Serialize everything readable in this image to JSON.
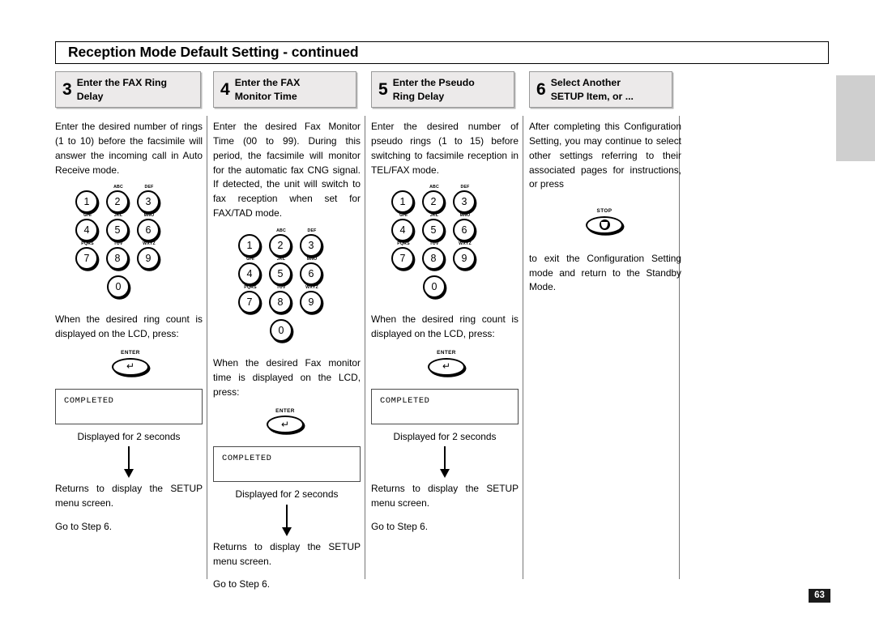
{
  "header": {
    "title": "Reception Mode Default Setting - continued"
  },
  "steps": [
    {
      "number": "3",
      "label_line1": "Enter the FAX Ring",
      "label_line2": "Delay"
    },
    {
      "number": "4",
      "label_line1": "Enter the FAX",
      "label_line2": "Monitor Time"
    },
    {
      "number": "5",
      "label_line1": "Enter the Pseudo",
      "label_line2": "Ring Delay"
    },
    {
      "number": "6",
      "label_line1": "Select Another",
      "label_line2": "SETUP Item, or ..."
    }
  ],
  "keypad": {
    "rows": [
      [
        {
          "digit": "1",
          "letters": ""
        },
        {
          "digit": "2",
          "letters": "ABC"
        },
        {
          "digit": "3",
          "letters": "DEF"
        }
      ],
      [
        {
          "digit": "4",
          "letters": "GHI"
        },
        {
          "digit": "5",
          "letters": "JKL"
        },
        {
          "digit": "6",
          "letters": "MNO"
        }
      ],
      [
        {
          "digit": "7",
          "letters": "PQRS"
        },
        {
          "digit": "8",
          "letters": "TUV"
        },
        {
          "digit": "9",
          "letters": "WXYZ"
        }
      ]
    ],
    "zero": {
      "digit": "0",
      "letters": ""
    }
  },
  "buttons": {
    "enter_label": "ENTER",
    "enter_glyph": "↵",
    "stop_label": "STOP"
  },
  "columns": {
    "col1": {
      "intro": "Enter the desired number of rings (1 to 10) before the facsimile will answer the incoming call in Auto Receive mode.",
      "after_keypad": "When the desired ring count is displayed on the LCD, press:",
      "lcd_text": "COMPLETED",
      "lcd_caption": "Displayed for 2 seconds",
      "returns": "Returns to display the SETUP menu screen.",
      "goto": "Go to Step 6."
    },
    "col2": {
      "intro": "Enter the desired Fax Monitor Time (00 to 99). During this period, the facsimile will monitor for the automatic fax CNG signal. If detected, the unit will switch to fax reception when set for FAX/TAD mode.",
      "after_keypad": "When the desired Fax monitor time is displayed on the LCD, press:",
      "lcd_text": "COMPLETED",
      "lcd_caption": "Displayed for 2 seconds",
      "returns": "Returns to display the SETUP menu screen.",
      "goto": "Go to Step 6."
    },
    "col3": {
      "intro": "Enter the desired number of pseudo rings (1 to 15) before switching to facsimile reception in TEL/FAX mode.",
      "after_keypad": "When the desired ring count is displayed on the LCD, press:",
      "lcd_text": "COMPLETED",
      "lcd_caption": "Displayed for 2 seconds",
      "returns": "Returns to display the SETUP menu screen.",
      "goto": "Go to Step 6."
    },
    "col4": {
      "intro": "After completing this Configuration Setting, you may continue to select other settings referring to their associated pages for instructions, or press",
      "outro": "to exit the Configuration Setting mode and return to the Standby Mode."
    }
  },
  "footer": {
    "page_number": "63"
  }
}
